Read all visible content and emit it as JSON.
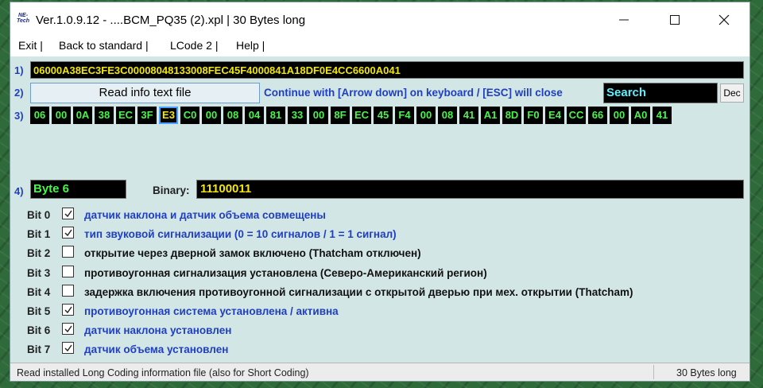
{
  "window": {
    "title": "Ver.1.0.9.12 - ....BCM_PQ35 (2).xpl | 30 Bytes long",
    "icon_text_top": "NE-",
    "icon_text_bottom": "Tech",
    "minimize_icon": "minimize-icon",
    "maximize_icon": "maximize-icon",
    "close_icon": "close-icon"
  },
  "menu": [
    {
      "label": "Exit |"
    },
    {
      "label": "Back to standard |"
    },
    {
      "label": "LCode 2 |"
    },
    {
      "label": "Help |"
    }
  ],
  "row_labels": [
    "1)",
    "2)",
    "3)",
    "4)"
  ],
  "long_coding": "06000A38EC3FE3C00008048133008FEC45F4000841A18DF0E4CC6600A041",
  "read_button": "Read info text file",
  "info_text": "Continue with [Arrow down] on keyboard / [ESC] will close",
  "search_value": "Search",
  "dec_button": "Dec",
  "bytes": [
    "06",
    "00",
    "0A",
    "38",
    "EC",
    "3F",
    "E3",
    "C0",
    "00",
    "08",
    "04",
    "81",
    "33",
    "00",
    "8F",
    "EC",
    "45",
    "F4",
    "00",
    "08",
    "41",
    "A1",
    "8D",
    "F0",
    "E4",
    "CC",
    "66",
    "00",
    "A0",
    "41"
  ],
  "selected_byte_index": 6,
  "byte_field": "Byte 6",
  "binary_label": "Binary:",
  "binary_value": "11100011",
  "colors": {
    "enabled_bit_text": "#1f3fc0",
    "disabled_bit_text": "#111111",
    "hex_text": "#f2e700",
    "byte_text": "#4af44a",
    "search_text": "#5ef1ff"
  },
  "bits": [
    {
      "label": "Bit 0",
      "checked": true,
      "text": "датчик наклона и датчик объема совмещены"
    },
    {
      "label": "Bit 1",
      "checked": true,
      "text": "тип звуковой сигнализации (0 = 10 сигналов / 1 = 1 сигнал)"
    },
    {
      "label": "Bit 2",
      "checked": false,
      "text": "открытие через дверной замок включено (Thatcham отключен)"
    },
    {
      "label": "Bit 3",
      "checked": false,
      "text": "противоугонная сигнализация установлена (Северо-Американский регион)"
    },
    {
      "label": "Bit 4",
      "checked": false,
      "text": "задержка включения противоугонной сигнализации с открытой дверью при мех. открытии (Thatcham)"
    },
    {
      "label": "Bit 5",
      "checked": true,
      "text": "противоугонная система установлена / активна"
    },
    {
      "label": "Bit 6",
      "checked": true,
      "text": "датчик наклона установлен"
    },
    {
      "label": "Bit 7",
      "checked": true,
      "text": "датчик объема установлен"
    }
  ],
  "status": {
    "left": "Read installed Long Coding information file (also for Short Coding)",
    "right": "30 Bytes long"
  }
}
